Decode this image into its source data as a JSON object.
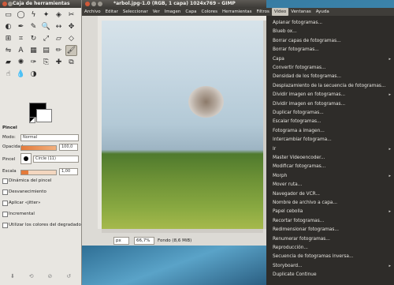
{
  "toolbox": {
    "title": "Caja de herramientas",
    "tool_icons": [
      "rect-select-icon",
      "ellipse-select-icon",
      "free-select-icon",
      "fuzzy-select-icon",
      "color-select-icon",
      "scissors-icon",
      "foreground-select-icon",
      "paths-icon",
      "color-picker-icon",
      "zoom-icon",
      "measure-icon",
      "move-icon",
      "align-icon",
      "crop-icon",
      "rotate-icon",
      "scale-icon",
      "shear-icon",
      "perspective-icon",
      "flip-icon",
      "text-icon",
      "bucket-fill-icon",
      "blend-icon",
      "pencil-icon",
      "paintbrush-icon",
      "eraser-icon",
      "airbrush-icon",
      "ink-icon",
      "clone-icon",
      "heal-icon",
      "perspective-clone-icon",
      "smudge-icon",
      "blur-icon",
      "dodge-icon"
    ],
    "tool_glyphs": [
      "▭",
      "◯",
      "ϟ",
      "✦",
      "◈",
      "✂",
      "◐",
      "✒",
      "✎",
      "🔍",
      "↔",
      "✥",
      "⊞",
      "⌗",
      "↻",
      "⤢",
      "▱",
      "◇",
      "⇋",
      "A",
      "▦",
      "▤",
      "✏",
      "🖌",
      "▰",
      "✺",
      "✑",
      "⎘",
      "✚",
      "⧉",
      "☝",
      "💧",
      "◑"
    ],
    "selected_tool": 23,
    "brush": {
      "section_title": "Pincel",
      "mode_label": "Modo:",
      "mode_value": "Normal",
      "opacity_label": "Opacidad",
      "opacity_value": "100,0",
      "brush_label": "Pincel",
      "brush_value": "Circle (11)",
      "scale_label": "Escala",
      "scale_value": "1,00",
      "options": [
        {
          "label": "Dinámica del pincel",
          "checked": false
        },
        {
          "label": "Desvanecimiento",
          "checked": false
        },
        {
          "label": "Aplicar «jitter»",
          "checked": false
        },
        {
          "label": "Incremental",
          "checked": false
        },
        {
          "label": "Utilizar los colores del degradado",
          "checked": false
        }
      ]
    }
  },
  "image_window": {
    "title": "*arbol.jpg-1.0 (RGB, 1 capa) 1024x769 – GIMP",
    "menu": [
      "Archivo",
      "Editar",
      "Seleccionar",
      "Ver",
      "Imagen",
      "Capa",
      "Colores",
      "Herramientas",
      "Filtros",
      "Video",
      "Ventanas",
      "Ayuda"
    ],
    "active_menu": "Video",
    "status": {
      "unit": "px",
      "zoom": "66,7%",
      "info": "Fondo (8,6 MiB)"
    }
  },
  "video_menu": {
    "items": [
      {
        "label": "Aplanar fotogramas...",
        "submenu": false
      },
      {
        "label": "Blueb ox...",
        "submenu": false
      },
      {
        "label": "Borrar capas de fotogramas...",
        "submenu": false
      },
      {
        "label": "Borrar fotogramas...",
        "submenu": false
      },
      {
        "label": "Capa",
        "submenu": true
      },
      {
        "label": "Convertir fotogramas...",
        "submenu": false
      },
      {
        "label": "Densidad de los fotogramas...",
        "submenu": false
      },
      {
        "label": "Desplazamiento de la secuencia de fotogramas...",
        "submenu": false
      },
      {
        "label": "Dividir imagen en fotogramas...",
        "submenu": true
      },
      {
        "label": "Dividir imagen en fotogramas...",
        "submenu": false
      },
      {
        "label": "Duplicar fotogramas...",
        "submenu": false
      },
      {
        "label": "Escalar fotogramas...",
        "submenu": false
      },
      {
        "label": "Fotograma a imagen...",
        "submenu": false
      },
      {
        "label": "Intercambiar fotograma...",
        "submenu": false
      },
      {
        "label": "Ir",
        "submenu": true
      },
      {
        "label": "Master Videoencoder...",
        "submenu": false
      },
      {
        "label": "Modificar fotogramas...",
        "submenu": false
      },
      {
        "label": "Morph",
        "submenu": true
      },
      {
        "label": "Mover ruta...",
        "submenu": false
      },
      {
        "label": "Navegador de VCR...",
        "submenu": false
      },
      {
        "label": "Nombre de archivo a capa...",
        "submenu": false
      },
      {
        "label": "Papel cebolla",
        "submenu": true
      },
      {
        "label": "Recortar fotogramas...",
        "submenu": false
      },
      {
        "label": "Redimensionar fotogramas...",
        "submenu": false
      },
      {
        "label": "Renumerar fotogramas...",
        "submenu": false
      },
      {
        "label": "Reproducción...",
        "submenu": false
      },
      {
        "label": "Secuencia de fotogramas inversa...",
        "submenu": false
      },
      {
        "label": "Storyboard...",
        "submenu": true
      },
      {
        "label": "Duplicate Continue",
        "submenu": false
      }
    ]
  }
}
